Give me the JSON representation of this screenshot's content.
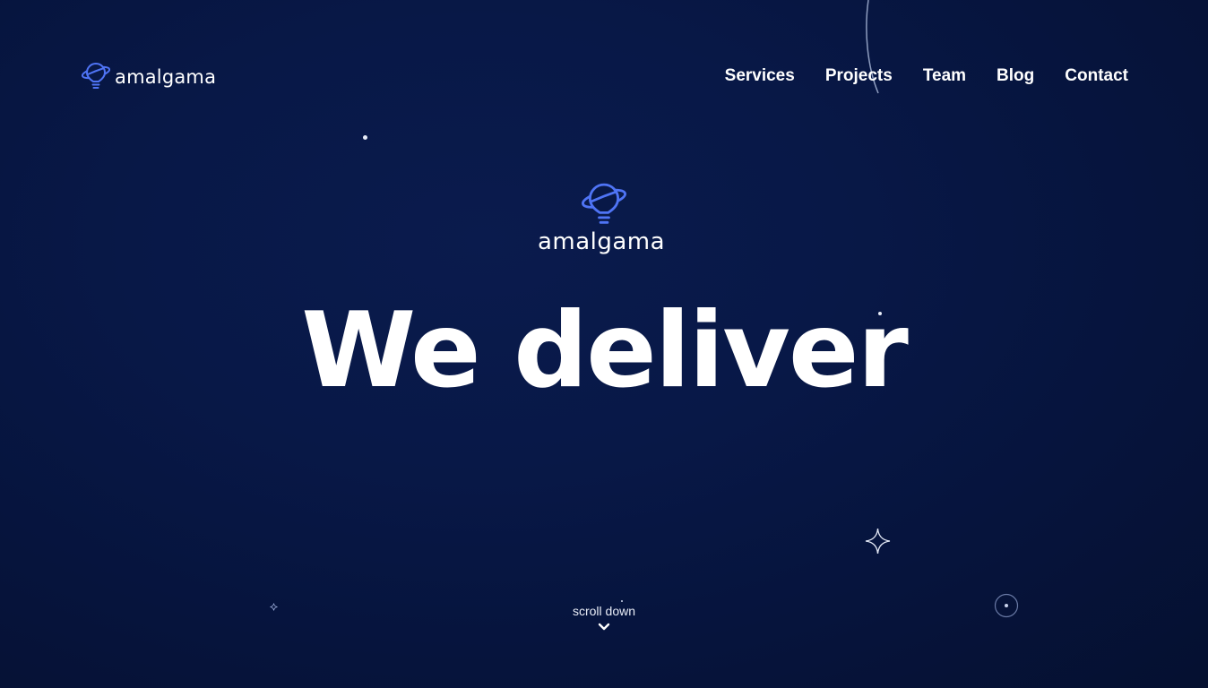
{
  "colors": {
    "background": "#081847",
    "accent": "#4f74f5",
    "text": "#ffffff"
  },
  "header": {
    "logo_icon": "planet-bulb-icon",
    "logo_text": "amalgama"
  },
  "nav": {
    "items": [
      {
        "label": "Services"
      },
      {
        "label": "Projects"
      },
      {
        "label": "Team"
      },
      {
        "label": "Blog"
      },
      {
        "label": "Contact"
      }
    ]
  },
  "hero": {
    "logo_icon": "planet-bulb-icon",
    "logo_text": "amalgama",
    "headline": "We deliver"
  },
  "scroll": {
    "label": "scroll down",
    "icon": "chevron-down-icon"
  },
  "decorations": [
    "star-dot-icon",
    "sparkle-icon",
    "ring-icon",
    "orbit-arc-icon"
  ]
}
